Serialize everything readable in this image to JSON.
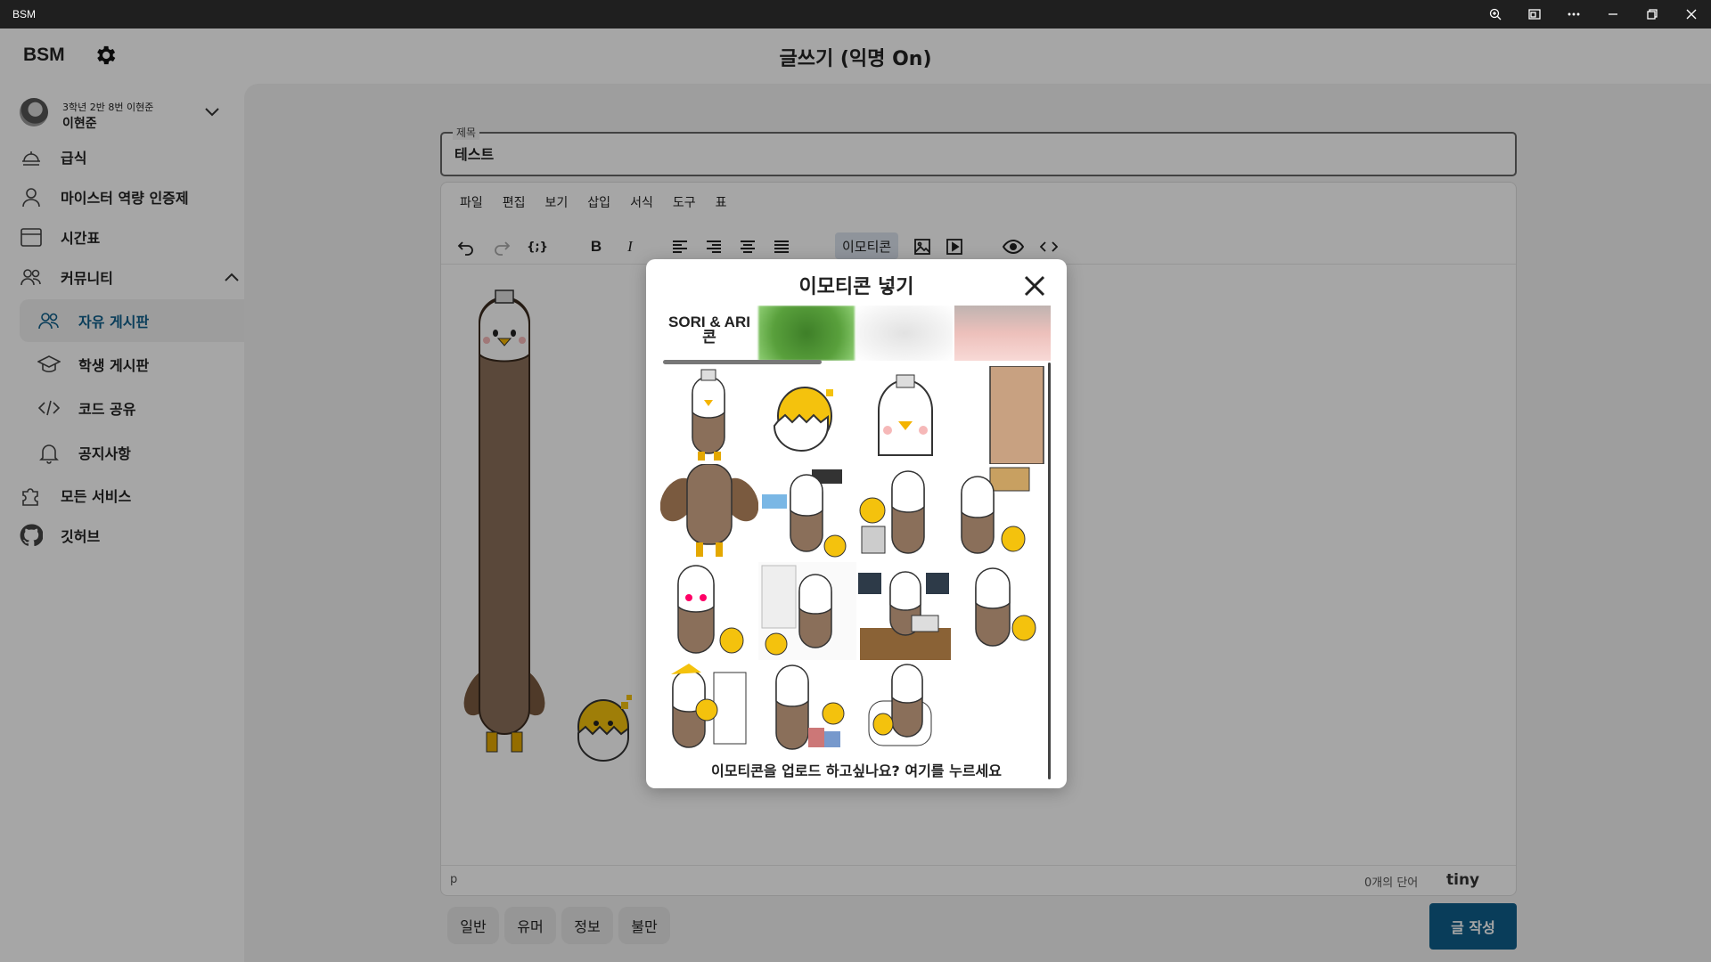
{
  "window": {
    "title": "BSM",
    "controls": [
      "zoom-icon",
      "cast-icon",
      "more-icon",
      "minimize-icon",
      "restore-icon",
      "close-icon"
    ]
  },
  "header": {
    "logo": "BSM",
    "page_title": "글쓰기 (익명 On)"
  },
  "user": {
    "sub": "3학년 2반 8번 이현준",
    "name": "이현준"
  },
  "sidebar": {
    "items": [
      {
        "label": "급식",
        "icon": "meal-icon"
      },
      {
        "label": "마이스터 역량 인증제",
        "icon": "person-icon"
      },
      {
        "label": "시간표",
        "icon": "calendar-icon"
      },
      {
        "label": "커뮤니티",
        "icon": "people-icon"
      },
      {
        "label": "모든 서비스",
        "icon": "puzzle-icon"
      },
      {
        "label": "깃허브",
        "icon": "github-icon"
      }
    ],
    "community": [
      {
        "label": "자유 게시판",
        "icon": "people-icon",
        "active": true
      },
      {
        "label": "학생 게시판",
        "icon": "school-icon"
      },
      {
        "label": "코드 공유",
        "icon": "code-icon"
      },
      {
        "label": "공지사항",
        "icon": "bell-icon"
      }
    ]
  },
  "form": {
    "title_legend": "제목",
    "title_value": "테스트"
  },
  "editor": {
    "menus": [
      "파일",
      "편집",
      "보기",
      "삽입",
      "서식",
      "도구",
      "표"
    ],
    "emoticon_button": "이모티콘",
    "status_path": "p",
    "word_count": "0개의 단어",
    "brand": "tiny"
  },
  "categories": [
    "일반",
    "유머",
    "정보",
    "불만"
  ],
  "submit_label": "글 작성",
  "modal": {
    "title": "이모티콘 넣기",
    "tab1_label_line1": "SORI & ARI",
    "tab1_label_line2": "콘",
    "upload_text": "이모티콘을 업로드 하고싶나요? 여기를 누르세요"
  },
  "colors": {
    "accent": "#0e5f8a",
    "eagle_brown": "#8a6f5a",
    "chick_yellow": "#f4c20d"
  }
}
